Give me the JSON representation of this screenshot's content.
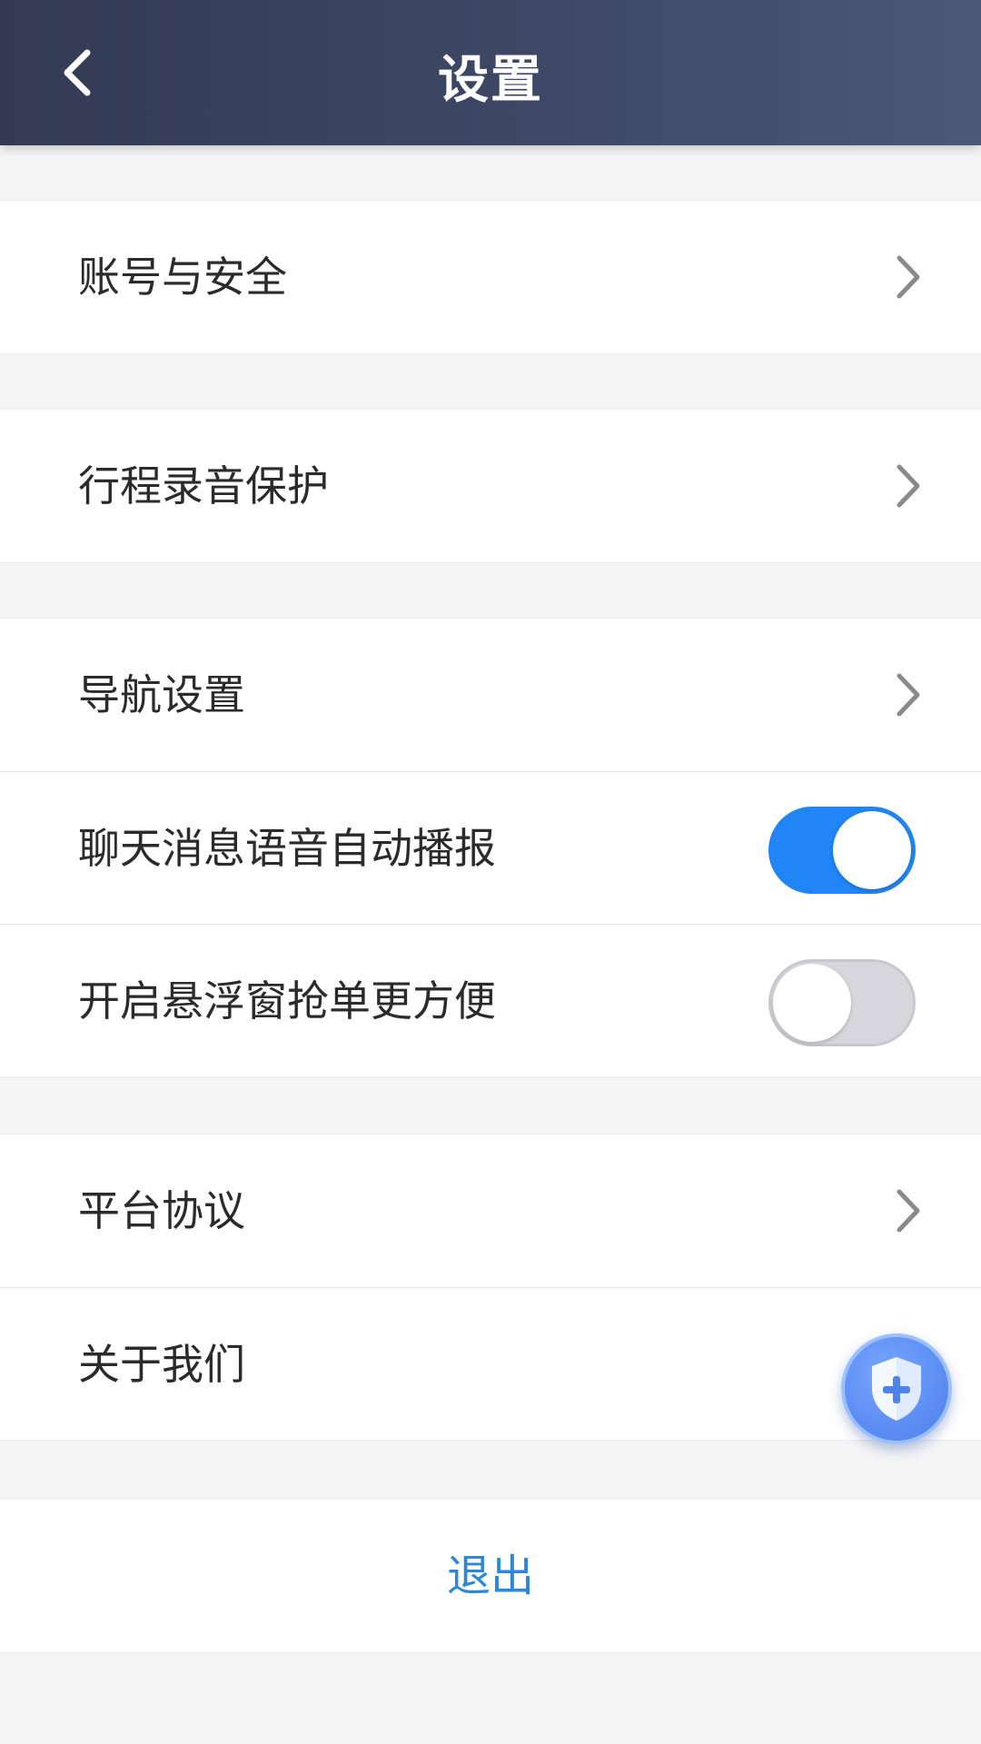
{
  "header": {
    "title": "设置"
  },
  "sections": [
    {
      "rows": [
        {
          "label": "账号与安全",
          "type": "link"
        }
      ]
    },
    {
      "rows": [
        {
          "label": "行程录音保护",
          "type": "link"
        }
      ]
    },
    {
      "rows": [
        {
          "label": "导航设置",
          "type": "link"
        },
        {
          "label": "聊天消息语音自动播报",
          "type": "toggle",
          "on": true
        },
        {
          "label": "开启悬浮窗抢单更方便",
          "type": "toggle",
          "on": false
        }
      ]
    },
    {
      "rows": [
        {
          "label": "平台协议",
          "type": "link"
        },
        {
          "label": "关于我们",
          "type": "link"
        }
      ]
    }
  ],
  "logout": {
    "label": "退出"
  },
  "colors": {
    "accent": "#2185f5",
    "logout_text": "#2c86dc",
    "header_start": "#323a53",
    "header_end": "#4b5878",
    "page_bg": "#f5f5f6"
  },
  "icons": {
    "back": "chevron-left-icon",
    "row_arrow": "chevron-right-icon",
    "fab": "shield-plus-icon"
  }
}
